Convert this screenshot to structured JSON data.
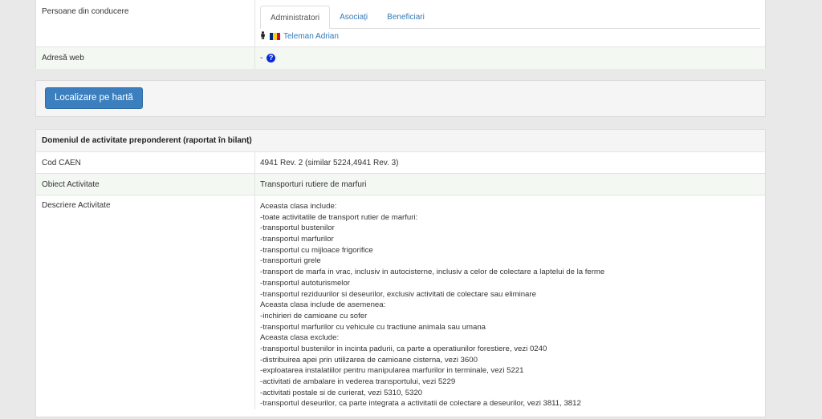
{
  "persons": {
    "label": "Persoane din conducere",
    "tabs": [
      "Administratori",
      "Asociați",
      "Beneficiari"
    ],
    "person_name": "Teleman Adrian",
    "flag_colors": [
      "#002b7f",
      "#fcd116",
      "#ce1126"
    ]
  },
  "web": {
    "label": "Adresă web",
    "value": "-",
    "help_glyph": "?"
  },
  "map": {
    "button_label": "Localizare pe hartă"
  },
  "activity": {
    "title": "Domeniul de activitate preponderent (raportat în bilanț)",
    "caen_label": "Cod CAEN",
    "caen_value": "4941 Rev. 2  (similar 5224,4941 Rev. 3)",
    "object_label": "Obiect Activitate",
    "object_value": "Transporturi rutiere de marfuri",
    "description_label": "Descriere Activitate",
    "description_lines": [
      "Aceasta clasa include:",
      "-toate activitatile de transport rutier de marfuri:",
      "-transportul bustenilor",
      "-transportul marfurilor",
      "-transportul cu mijloace frigorifice",
      "-transporturi grele",
      "-transport de marfa in vrac, inclusiv in autocisterne, inclusiv a celor de colectare a laptelui de la ferme",
      "-transportul autoturismelor",
      "-transportul reziduurilor si deseurilor, exclusiv activitati de colectare sau eliminare",
      "Aceasta clasa include de asemenea:",
      "-inchirieri de camioane cu sofer",
      "-transportul marfurilor cu vehicule cu tractiune animala sau umana",
      "Aceasta clasa exclude:",
      "-transportul bustenilor in incinta padurii, ca parte a operatiunilor forestiere, vezi 0240",
      "-distribuirea apei prin utilizarea de camioane cisterna, vezi 3600",
      "-exploatarea instalatiilor pentru manipularea marfurilor in terminale, vezi 5221",
      "-activitati de ambalare in vederea transportului, vezi 5229",
      "-activitati postale si de curierat, vezi 5310, 5320",
      "-transportul deseurilor, ca parte integrata a activitatii de colectare a deseurilor, vezi 3811, 3812"
    ]
  },
  "colors": {
    "link": "#337ab7",
    "button": "#3c7fbe",
    "row_highlight": "#f3f8f2",
    "background": "#e9e9ea"
  }
}
